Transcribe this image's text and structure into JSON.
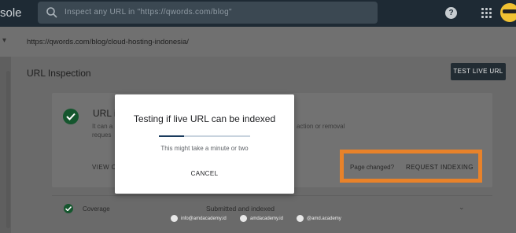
{
  "header": {
    "app_title": "sole",
    "search_placeholder": "Inspect any URL in \"https://qwords.com/blog\""
  },
  "url_bar": {
    "url": "https://qwords.com/blog/cloud-hosting-indonesia/"
  },
  "panel": {
    "title": "URL Inspection",
    "test_live_label": "TEST LIVE URL"
  },
  "card": {
    "title": "URL is",
    "desc_line1": "It can a",
    "desc_line2": "reques",
    "desc_right": "action or removal",
    "view_crawled_label": "VIEW C",
    "page_changed_label": "Page changed?",
    "request_indexing_label": "REQUEST INDEXING"
  },
  "coverage": {
    "label": "Coverage",
    "value": "Submitted and indexed"
  },
  "dialog": {
    "title": "Testing if live URL can be indexed",
    "subtitle": "This might take a minute or two",
    "cancel_label": "CANCEL",
    "progress": 0.28
  },
  "watermark": {
    "email": "info@amdacademy.id",
    "site": "amdacademy.id",
    "handle": "@amd.academy"
  },
  "colors": {
    "highlight": "#e8822a",
    "success": "#15562e",
    "progress": "#1a3b5d"
  }
}
